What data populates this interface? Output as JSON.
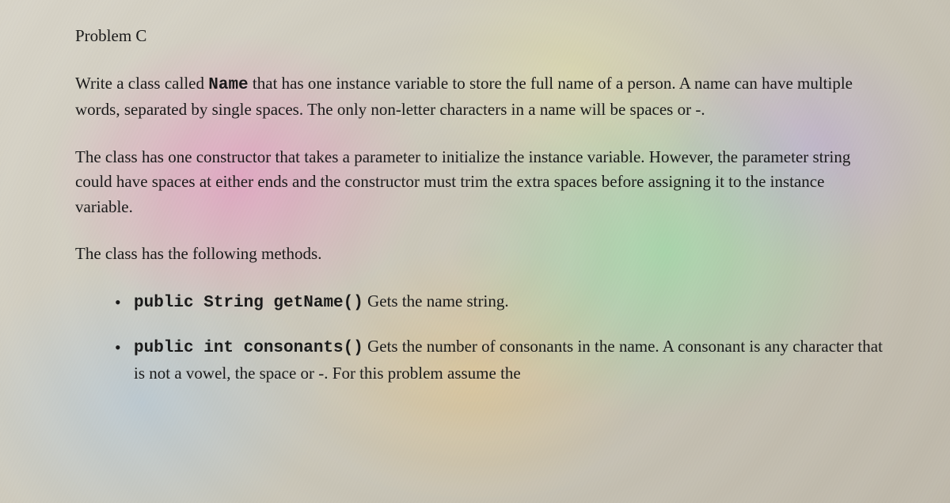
{
  "title": "Problem C",
  "para1_prefix": "Write a class called ",
  "para1_code": "Name",
  "para1_suffix": " that has one instance variable to store the full name of a person. A name can have multiple words, separated by single spaces. The only non-letter characters in a name will be spaces or -.",
  "para2": "The class has one constructor that takes a parameter to initialize the instance variable. However, the parameter string could have spaces at either ends and the constructor must trim the extra spaces before assigning it to the instance variable.",
  "para3": "The class has the following methods.",
  "bullet1_code": "public String getName()",
  "bullet1_text": " Gets the name string.",
  "bullet2_code": "public int consonants()",
  "bullet2_text": " Gets the number of consonants in the name. A consonant is any character that is not a vowel, the space or -. For this problem assume the"
}
